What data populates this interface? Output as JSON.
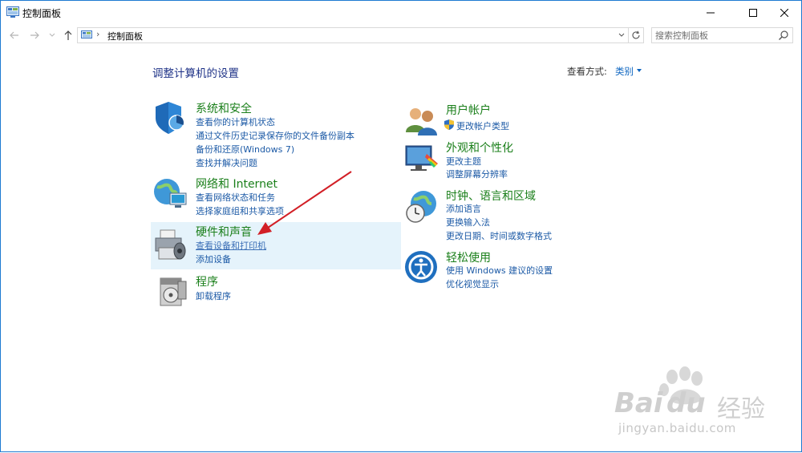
{
  "window": {
    "title": "控制面板"
  },
  "address": {
    "breadcrumb": "控制面板",
    "separator": "›"
  },
  "search": {
    "placeholder": "搜索控制面板"
  },
  "page": {
    "heading": "调整计算机的设置",
    "view_by_label": "查看方式:",
    "view_by_value": "类别"
  },
  "categories": {
    "system": {
      "title": "系统和安全",
      "links": [
        "查看你的计算机状态",
        "通过文件历史记录保存你的文件备份副本",
        "备份和还原(Windows 7)",
        "查找并解决问题"
      ]
    },
    "network": {
      "title": "网络和 Internet",
      "links": [
        "查看网络状态和任务",
        "选择家庭组和共享选项"
      ]
    },
    "hardware": {
      "title": "硬件和声音",
      "links": [
        "查看设备和打印机",
        "添加设备"
      ]
    },
    "programs": {
      "title": "程序",
      "links": [
        "卸载程序"
      ]
    },
    "users": {
      "title": "用户帐户",
      "links": [
        "更改帐户类型"
      ]
    },
    "appearance": {
      "title": "外观和个性化",
      "links": [
        "更改主题",
        "调整屏幕分辨率"
      ]
    },
    "clock": {
      "title": "时钟、语言和区域",
      "links": [
        "添加语言",
        "更换输入法",
        "更改日期、时间或数字格式"
      ]
    },
    "ease": {
      "title": "轻松使用",
      "links": [
        "使用 Windows 建议的设置",
        "优化视觉显示"
      ]
    }
  },
  "watermark": {
    "brand": "Bai",
    "brand2": "du",
    "cn": "经验",
    "url": "jingyan.baidu.com"
  },
  "colors": {
    "link": "#1c5aa6",
    "category_title": "#1a7f1a",
    "heading": "#1e3287",
    "highlight": "#e5f3fb",
    "arrow": "#d21f26"
  }
}
